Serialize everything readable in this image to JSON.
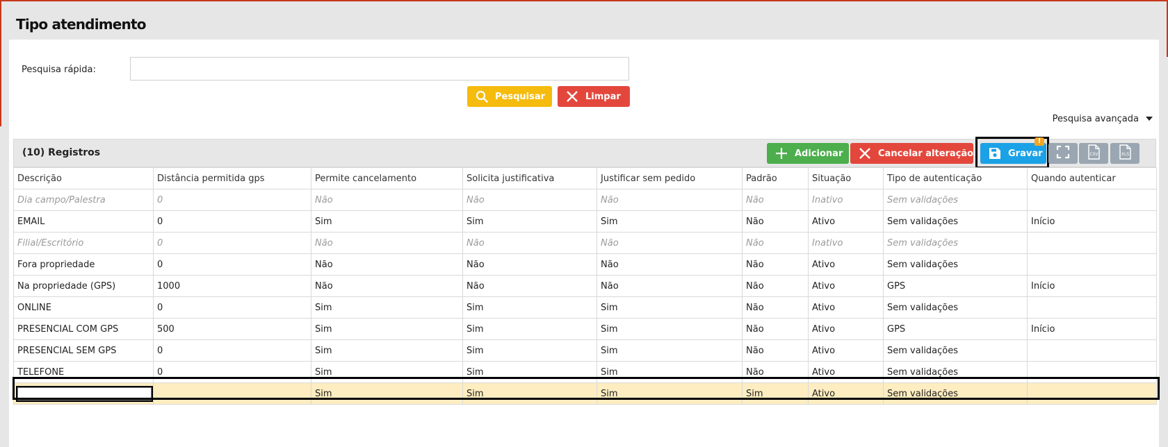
{
  "page": {
    "title": "Tipo atendimento"
  },
  "search": {
    "label": "Pesquisa rápida:",
    "value": "",
    "placeholder": "",
    "search_button": "Pesquisar",
    "clear_button": "Limpar",
    "advanced_label": "Pesquisa avançada"
  },
  "grid": {
    "records_label": "(10) Registros",
    "toolbar": {
      "add": "Adicionar",
      "cancel": "Cancelar alteração",
      "save": "Gravar",
      "save_badge": "!"
    },
    "columns": [
      "Descrição",
      "Distância permitida gps",
      "Permite cancelamento",
      "Solicita justificativa",
      "Justificar sem pedido",
      "Padrão",
      "Situação",
      "Tipo de autenticação",
      "Quando autenticar"
    ],
    "rows": [
      [
        "Dia campo/Palestra",
        "0",
        "Não",
        "Não",
        "Não",
        "Não",
        "Inativo",
        "Sem validações",
        ""
      ],
      [
        "EMAIL",
        "0",
        "Sim",
        "Sim",
        "Sim",
        "Não",
        "Ativo",
        "Sem validações",
        "Início"
      ],
      [
        "Filial/Escritório",
        "0",
        "Não",
        "Não",
        "Não",
        "Não",
        "Inativo",
        "Sem validações",
        ""
      ],
      [
        "Fora propriedade",
        "0",
        "Não",
        "Não",
        "Não",
        "Não",
        "Ativo",
        "Sem validações",
        ""
      ],
      [
        "Na propriedade (GPS)",
        "1000",
        "Não",
        "Não",
        "Não",
        "Não",
        "Ativo",
        "GPS",
        "Início"
      ],
      [
        "ONLINE",
        "0",
        "Sim",
        "Sim",
        "Sim",
        "Não",
        "Ativo",
        "Sem validações",
        ""
      ],
      [
        "PRESENCIAL COM GPS",
        "500",
        "Sim",
        "Sim",
        "Sim",
        "Não",
        "Ativo",
        "GPS",
        "Início"
      ],
      [
        "PRESENCIAL SEM GPS",
        "0",
        "Sim",
        "Sim",
        "Sim",
        "Não",
        "Ativo",
        "Sem validações",
        ""
      ],
      [
        "TELEFONE",
        "0",
        "Sim",
        "Sim",
        "Sim",
        "Não",
        "Ativo",
        "Sem validações",
        ""
      ]
    ],
    "inactive_value": "Inativo",
    "new_row": {
      "description": "",
      "distance": "",
      "permite_cancelamento": "Sim",
      "solicita_justificativa": "Sim",
      "justificar_sem_pedido": "Sim",
      "padrao": "Sim",
      "situacao": "Ativo",
      "tipo_autenticacao": "Sem validações",
      "quando_autenticar": ""
    }
  },
  "colors": {
    "accent_red": "#c8371c",
    "search_button": "#f5bb0d",
    "clear_button": "#e3473c",
    "add_button": "#4cae4c",
    "cancel_button": "#e3473c",
    "save_button": "#1ba1e6",
    "icon_button": "#9aa6b1",
    "new_row_bg": "#fdedc0",
    "badge": "#f5a623"
  },
  "icons": {
    "search": "search-icon",
    "clear": "close-icon",
    "add": "plus-icon",
    "cancel": "close-icon",
    "save": "save-icon",
    "fullscreen": "fullscreen-icon",
    "csv": "csv-icon",
    "xls": "xls-icon",
    "advanced": "caret-down-icon"
  }
}
